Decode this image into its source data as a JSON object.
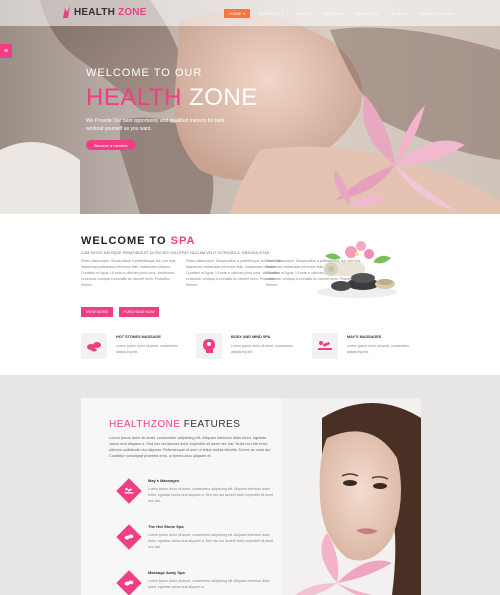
{
  "brand": {
    "word1": "HEALTH",
    "word2": "ZONE"
  },
  "nav": [
    "HOME ▾",
    "SERVICES ▾",
    "ABOUT",
    "PAGES ▾",
    "GALLERY ▾",
    "BLOG ▾",
    "SHORTCODES ▾"
  ],
  "hero": {
    "welcome": "WELCOME TO OUR",
    "title_pink": "HEALTH",
    "title_white": "ZONE",
    "desc": "We Provide Our best opportunity and qualified trainers for best workout yourself as you want.",
    "button": "Become a member"
  },
  "spa": {
    "title_prefix": "WELCOME TO",
    "title_pink": "SPA",
    "subhead": "CUM SOCIIS NATOQUE PENATIBUS ET ULTRICIES VOLUTPAT. NULLAM VELIT ULTRICIES A. GRAVIDA VITAE.",
    "col1": "Etiam ullamcorper. Suspendisse a pellentesque dui, non felis. Maecenas malesuada elit lectus felis, malesuada ultricies. Curabitur et ligula. Ut ante a, ultricies porta urna. Vestibulum commodo volutpat a convallis ac, laoreet enim. Phasellus fermen.",
    "col2": "Etiam ullamcorper. Suspendisse a pellentesque dui, non felis. Maecenas malesuada elit lectus felis, malesuada ultricies. Curabitur et ligula. Ut ante a, ultricies porta urna. Vestibulum commodo volutpat a convallis ac, laoreet enim. Phasellus fermen.",
    "col3": "Etiam ullamcorper. Suspendisse a pellentesque dui, non felis. Maecenas malesuada elit lectus felis, malesuada ultricies. Curabitur et ligula. Ut ante a, ultricies porta urna. Vestibulum commodo volutpat a convallis ac, laoreet enim. Phasellus fermen.",
    "button1": "VIEW MORE",
    "button2": "PURCHASE NOW",
    "services": [
      {
        "title": "HOT STONES MASSAGE",
        "text": "Lorem ipsum dolor sit amet, consectetur adipiscing elit."
      },
      {
        "title": "BODY AND MIND SPA",
        "text": "Lorem ipsum dolor sit amet, consectetur adipiscing elit."
      },
      {
        "title": "MAY'S MASSAGES",
        "text": "Lorem ipsum dolor sit amet, consectetur adipiscing elit."
      }
    ]
  },
  "features": {
    "title_pink": "HEALTHZONE",
    "title_rest": "FEATURES",
    "desc": "Lorem ipsum dolor sit amet, consectetur adipiscing elit. Aliquam interdum diam tortor, egestas varius erat aliquam a. Sed nec dui laoreet dolor imperdiet sit amet nec nisl. Nulla non elit enim, ultricies sollicitudin dui aliquam. Pellentesque ut sem ut tellus lacinia lobortis. Donec ac nulla dui. Curabitur consequat pharetra eros, a viverra arcu aliquam et.",
    "items": [
      {
        "title": "May's Massages",
        "text": "Lorem ipsum dolor sit amet, consectetur adipiscing elit. Aliquam interdum diam tortor, egestas varius erat aliquam a. Sed nec dui laoreet dolor imperdiet sit amet nec nisl."
      },
      {
        "title": "The Hot Stone Spa",
        "text": "Lorem ipsum dolor sit amet, consectetur adipiscing elit. Aliquam interdum diam tortor, egestas varius erat aliquam a. Sed nec dui laoreet dolor imperdiet sit amet nec nisl."
      },
      {
        "title": "Massage Away Spa",
        "text": "Lorem ipsum dolor sit amet, consectetur adipiscing elit. Aliquam interdum diam tortor, egestas varius erat aliquam a."
      }
    ]
  },
  "colors": {
    "accent": "#f03e85",
    "nav_active": "#f6763d"
  },
  "icons": [
    "hamburger-icon",
    "hot-stones-icon",
    "head-icon",
    "massage-icon"
  ]
}
